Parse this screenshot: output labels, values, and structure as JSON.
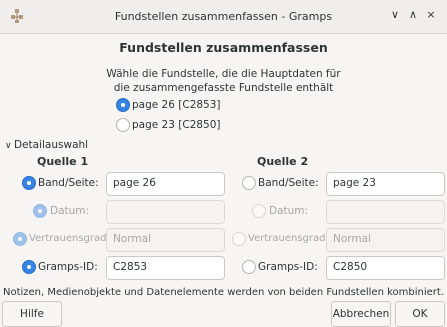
{
  "window": {
    "title": "Fundstellen zusammenfassen - Gramps",
    "controls": {
      "minimize": "∨",
      "maximize": "∧",
      "close": "×"
    }
  },
  "dialog": {
    "heading": "Fundstellen zusammenfassen",
    "instruction_line1": "Wähle die Fundstelle, die die Hauptdaten für",
    "instruction_line2": "die zusammengefasste Fundstelle enthält",
    "main_choice": [
      {
        "label": "page 26 [C2853]",
        "selected": true
      },
      {
        "label": "page 23 [C2850]",
        "selected": false
      }
    ]
  },
  "details": {
    "expander_label": "Detailauswahl",
    "source1_title": "Quelle 1",
    "source2_title": "Quelle 2",
    "source1": {
      "band_label": "Band/Seite:",
      "band_value": "page 26",
      "datum_label": "Datum:",
      "datum_value": "",
      "vertrauen_label": "Vertrauensgrad:",
      "vertrauen_value": "Normal",
      "gramps_label": "Gramps-ID:",
      "gramps_value": "C2853"
    },
    "source2": {
      "band_label": "Band/Seite:",
      "band_value": "page 23",
      "datum_label": "Datum:",
      "datum_value": "",
      "vertrauen_label": "Vertrauensgrad:",
      "vertrauen_value": "Normal",
      "gramps_label": "Gramps-ID:",
      "gramps_value": "C2850"
    }
  },
  "footer": {
    "note": "Notizen, Medienobjekte und Datenelemente werden von beiden Fundstellen kombiniert.",
    "help_button": "Hilfe",
    "cancel_button": "Abbrechen",
    "ok_button": "OK"
  },
  "colors": {
    "accent": "#3584e4",
    "background": "#f6f5f4",
    "disabled_text": "#a6a8a6"
  }
}
